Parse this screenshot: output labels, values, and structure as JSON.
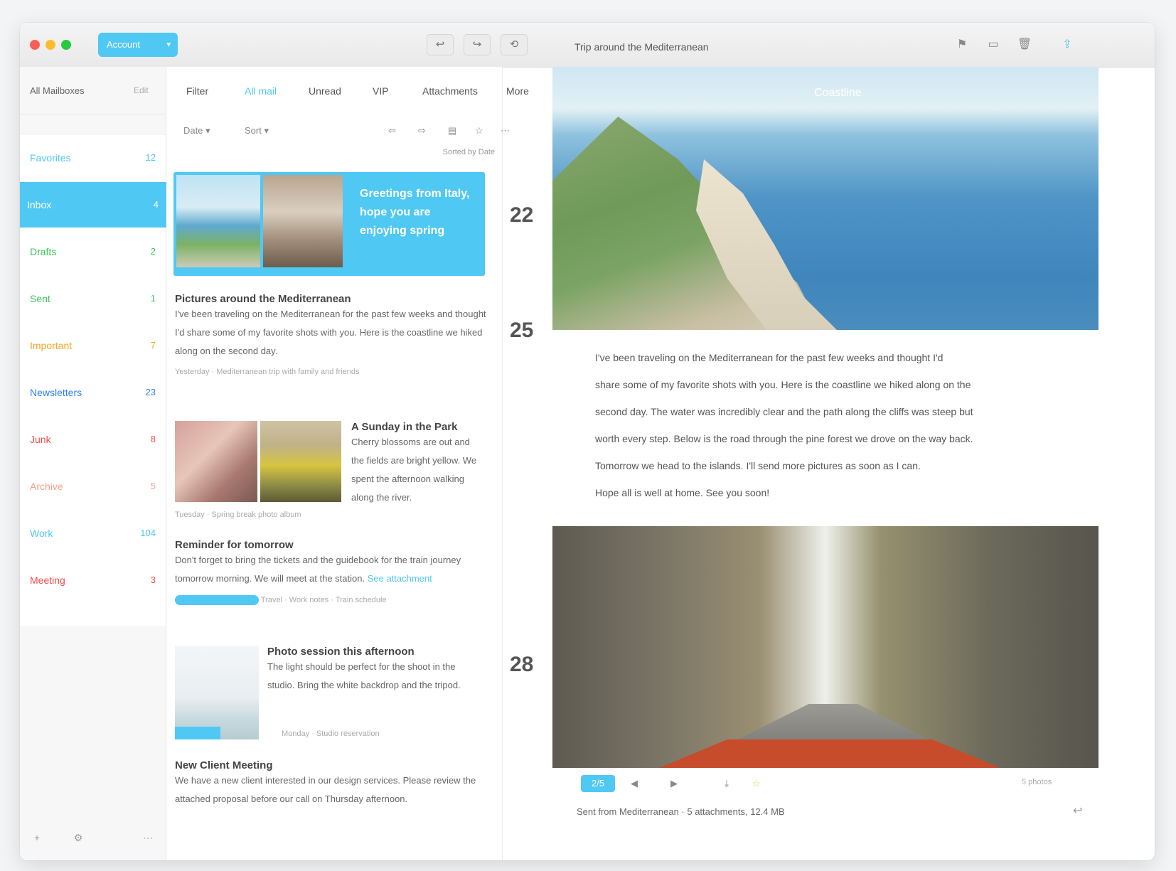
{
  "window": {
    "account": "Account",
    "subject": "Trip around the Mediterranean",
    "toolbar": [
      "↩",
      "↪",
      "⟲"
    ]
  },
  "sidebar": {
    "header_name": "All Mailboxes",
    "header_action": "Edit",
    "items": [
      {
        "label": "Favorites",
        "count": "12",
        "color": "#4fc8f3"
      },
      {
        "label": "Inbox",
        "count": "4",
        "color": "#ffffff"
      },
      {
        "label": "Drafts",
        "count": "2",
        "color": "#39c65a"
      },
      {
        "label": "Sent",
        "count": "1",
        "color": "#39c65a"
      },
      {
        "label": "Important",
        "count": "7",
        "color": "#f5a623"
      },
      {
        "label": "Newsletters",
        "count": "23",
        "color": "#2f80ed"
      },
      {
        "label": "Junk",
        "count": "8",
        "color": "#f54b4b"
      },
      {
        "label": "Archive",
        "count": "5",
        "color": "#f2a28a"
      },
      {
        "label": "Work",
        "count": "104",
        "color": "#4fc8f3"
      },
      {
        "label": "Meeting",
        "count": "3",
        "color": "#f54b4b"
      }
    ],
    "footer": [
      "+",
      "⚙",
      "⋯"
    ]
  },
  "msglist": {
    "search": "Filter",
    "tabs": [
      "All mail",
      "Unread",
      "VIP",
      "Attachments",
      "More"
    ],
    "tools": [
      "Date ▾",
      "Sort ▾",
      "⇦",
      "⇨",
      "▤",
      "☆",
      "⋯"
    ],
    "sort": "Sorted by Date",
    "featured_title": "Greetings from Italy, hope you are enjoying spring",
    "messages": [
      {
        "subject": "Pictures around the Mediterranean",
        "body": "I've been traveling on the Mediterranean for the past few weeks and thought I'd share some of my favorite shots with you. Here is the coastline we hiked along on the second day.",
        "meta": "Yesterday  ·  Mediterranean trip with family and friends"
      },
      {
        "subject": "A Sunday in the Park",
        "body": "Cherry blossoms are out and the fields are bright yellow. We spent the afternoon walking along the river.",
        "meta": "Tuesday  ·  Spring break photo album"
      },
      {
        "subject": "Reminder for tomorrow",
        "body": "Don't forget to bring the tickets and the guidebook for the train journey tomorrow morning. We will meet at the station.",
        "link": "See attachment",
        "meta_tags": [
          "Travel",
          "Work notes",
          "Train schedule"
        ]
      },
      {
        "subject": "Photo session this afternoon",
        "body": "The light should be perfect for the shoot in the studio. Bring the white backdrop and the tripod.",
        "meta": "Monday  ·  Studio reservation"
      },
      {
        "subject": "New Client Meeting",
        "body": "We have a new client interested in our design services. Please review the attached proposal before our call on Thursday afternoon."
      }
    ]
  },
  "dates": [
    "22",
    "25",
    "28"
  ],
  "reader": {
    "hero_caption": "Coastline",
    "paragraphs": [
      "I've been traveling on the Mediterranean for the past few weeks and thought I'd",
      "share some of my favorite shots with you. Here is the coastline we hiked along on the",
      "second day. The water was incredibly clear and the path along the cliffs was steep but",
      "worth every step. Below is the road through the pine forest we drove on the way back.",
      "Tomorrow we head to the islands. I'll send more pictures as soon as I can.",
      "Hope all is well at home. See you soon!"
    ],
    "attachments": [
      "2/5",
      "◀",
      "▶",
      "⤓",
      "☆"
    ],
    "attach_count": "5 photos",
    "footer_text": "Sent from Mediterranean  ·  5 attachments, 12.4 MB",
    "footer_icon": "reply-icon"
  },
  "colors": {
    "accent": "#4fc8f3"
  }
}
